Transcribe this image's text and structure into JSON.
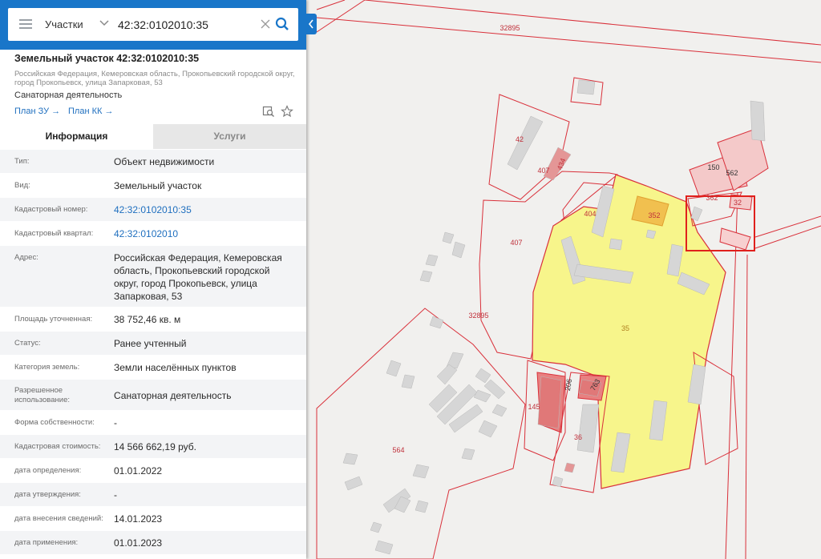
{
  "search": {
    "type_label": "Участки",
    "query": "42:32:0102010:35"
  },
  "object": {
    "title": "Земельный участок 42:32:0102010:35",
    "address_short": "Российская Федерация, Кемеровская область, Прокопьевский городской округ, город Прокопьевск, улица Запарковая, 53",
    "usage": "Санаторная деятельность",
    "plan_zu": "План ЗУ →",
    "plan_kk": "План КК →"
  },
  "tabs": [
    {
      "label": "Информация",
      "active": true
    },
    {
      "label": "Услуги",
      "active": false
    }
  ],
  "info": [
    {
      "label": "Тип:",
      "value": "Объект недвижимости"
    },
    {
      "label": "Вид:",
      "value": "Земельный участок"
    },
    {
      "label": "Кадастровый номер:",
      "value": "42:32:0102010:35",
      "link": true
    },
    {
      "label": "Кадастровый квартал:",
      "value": "42:32:0102010",
      "link": true
    },
    {
      "label": "Адрес:",
      "value": "Российская Федерация, Кемеровская область, Прокопьевский городской округ, город Прокопьевск, улица Запарковая, 53"
    },
    {
      "label": "Площадь уточненная:",
      "value": "38 752,46 кв. м"
    },
    {
      "label": "Статус:",
      "value": "Ранее учтенный"
    },
    {
      "label": "Категория земель:",
      "value": "Земли населённых пунктов"
    },
    {
      "label": "Разрешенное использование:",
      "value": "Санаторная деятельность"
    },
    {
      "label": "Форма собственности:",
      "value": "-"
    },
    {
      "label": "Кадастровая стоимость:",
      "value": "14 566 662,19 руб."
    },
    {
      "label": "дата определения:",
      "value": "01.01.2022"
    },
    {
      "label": "дата утверждения:",
      "value": "-"
    },
    {
      "label": "дата внесения сведений:",
      "value": "14.01.2023"
    },
    {
      "label": "дата применения:",
      "value": "01.01.2023"
    }
  ],
  "map_labels": {
    "q32895_top": "32895",
    "p42": "42",
    "p407a": "407",
    "p434": "434",
    "p404": "404",
    "p352": "352",
    "p407b": "407",
    "p150": "150",
    "p562": "562",
    "p362": "362",
    "p32": "32",
    "q32895_mid": "32895",
    "p35": "35",
    "p206": "206",
    "p145": "145",
    "p763": "763",
    "p36": "36",
    "p564": "564"
  },
  "colors": {
    "header_blue": "#1976c9",
    "selected_fill": "#f7f58b",
    "parcel_border": "#d9303a",
    "link": "#1f6fbf"
  },
  "icons": [
    "menu-icon",
    "chevron-down-icon",
    "clear-icon",
    "search-icon",
    "collapse-arrow-icon",
    "zoom-to-icon",
    "star-icon"
  ]
}
